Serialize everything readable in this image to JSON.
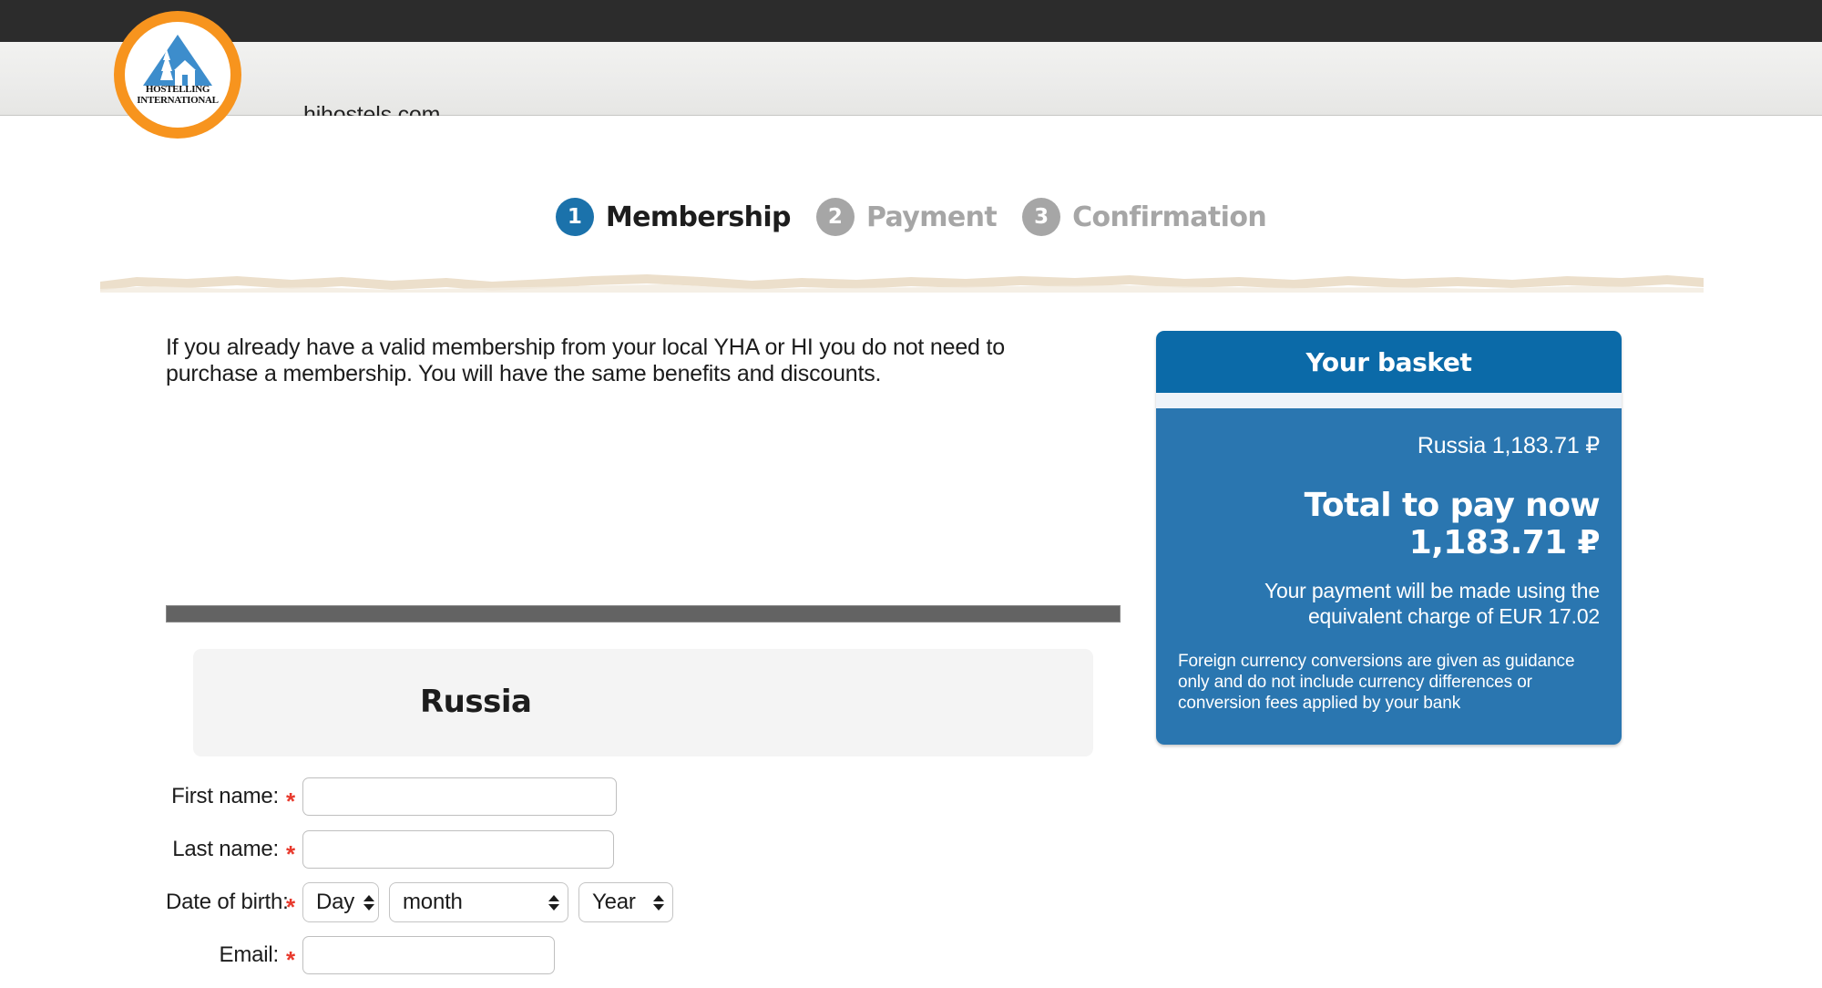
{
  "browser": {
    "url": "hihostels.com"
  },
  "logo": {
    "caption_line1": "HOSTELLING",
    "caption_line2": "INTERNATIONAL"
  },
  "steps": [
    {
      "number": "1",
      "label": "Membership",
      "state": "active"
    },
    {
      "number": "2",
      "label": "Payment",
      "state": "inactive"
    },
    {
      "number": "3",
      "label": "Confirmation",
      "state": "inactive"
    }
  ],
  "main": {
    "intro_text": "If you already have a valid membership from your local YHA or HI you do not need to purchase a membership. You will have the same benefits and discounts.",
    "country_name": "Russia"
  },
  "form": {
    "fields": [
      {
        "label": "First name:",
        "required": "*",
        "value": "",
        "placeholder": ""
      },
      {
        "label": "Last name:",
        "required": "*",
        "value": "",
        "placeholder": ""
      },
      {
        "label": "Date of birth:",
        "required": "*"
      },
      {
        "label": "Email:",
        "required": "*",
        "value": "",
        "placeholder": ""
      }
    ],
    "dob": {
      "day": "Day",
      "month": "month",
      "year": "Year"
    }
  },
  "basket": {
    "title": "Your basket",
    "line_item": "Russia 1,183.71 ₽",
    "total": "Total to pay now 1,183.71 ₽",
    "equivalent": "Your payment will be made using the equivalent charge of EUR 17.02",
    "note": "Foreign currency conversions are given as guidance only and do not include currency differences or conversion fees applied by your bank"
  },
  "colors": {
    "accent_blue": "#1b72ab",
    "basket_header": "#0b6aa8",
    "basket_body": "#2a76b0",
    "logo_orange": "#f7941e",
    "required_red": "#e8392c",
    "inactive_gray": "#a6a6a6"
  }
}
